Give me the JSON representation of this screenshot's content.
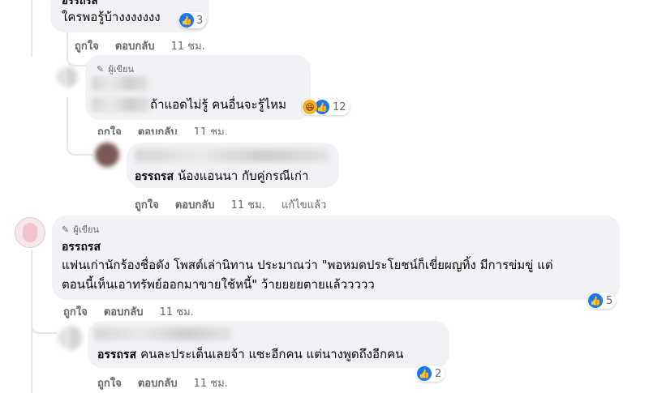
{
  "comments": [
    {
      "id": "c1",
      "author": "อรรถรส",
      "text": "ใครพอรู้บ้างงงงงงง",
      "reactions": {
        "icons": [
          "like"
        ],
        "count": "3"
      },
      "actions": {
        "like": "ถูกใจ",
        "reply": "ตอบกลับ",
        "time": "11 ชม."
      }
    },
    {
      "id": "c2",
      "author_tag": "ผู้เขียน",
      "text": "ถ้าแอดไม่รู้ คนอื่นจะรู้ไหม",
      "reactions": {
        "icons": [
          "haha",
          "like"
        ],
        "count": "12"
      },
      "actions": {
        "like": "ถูกใจ",
        "reply": "ตอบกลับ",
        "time": "11 ชม."
      }
    },
    {
      "id": "c3",
      "author": "อรรถรส",
      "text": "น้องแอนนา กับคู่กรณีเก่า",
      "actions": {
        "like": "ถูกใจ",
        "reply": "ตอบกลับ",
        "time": "11 ชม.",
        "edited": "แก้ไขแล้ว"
      }
    },
    {
      "id": "c4",
      "author_tag": "ผู้เขียน",
      "author": "อรรถรส",
      "text_line1": "แฟนเก่านักร้องชื่อดัง โพสต์เล่านิทาน ประมาณว่า \"พอหมดประโยชน์ก็เขี่ยผญทิ้ง มีการข่มขู่ แต่",
      "text_line2": "ตอนนี้เห็นเอาทรัพย์ออกมาขายใช้หนี้\" ว้ายยยยตายแล้ววววว",
      "reactions": {
        "icons": [
          "like"
        ],
        "count": "5"
      },
      "actions": {
        "like": "ถูกใจ",
        "reply": "ตอบกลับ",
        "time": "11 ชม."
      }
    },
    {
      "id": "c5",
      "author": "อรรถรส",
      "text": "คนละประเด็นเลยจ้า แซะอีกคน แต่นางพูดถึงอีกคน",
      "reactions": {
        "icons": [
          "like"
        ],
        "count": "2"
      },
      "actions": {
        "like": "ถูกใจ",
        "reply": "ตอบกลับ",
        "time": "11 ชม."
      }
    }
  ],
  "colors": {
    "bubble": "#f0f2f5",
    "like": "#1877f2",
    "meta": "#65676b"
  }
}
